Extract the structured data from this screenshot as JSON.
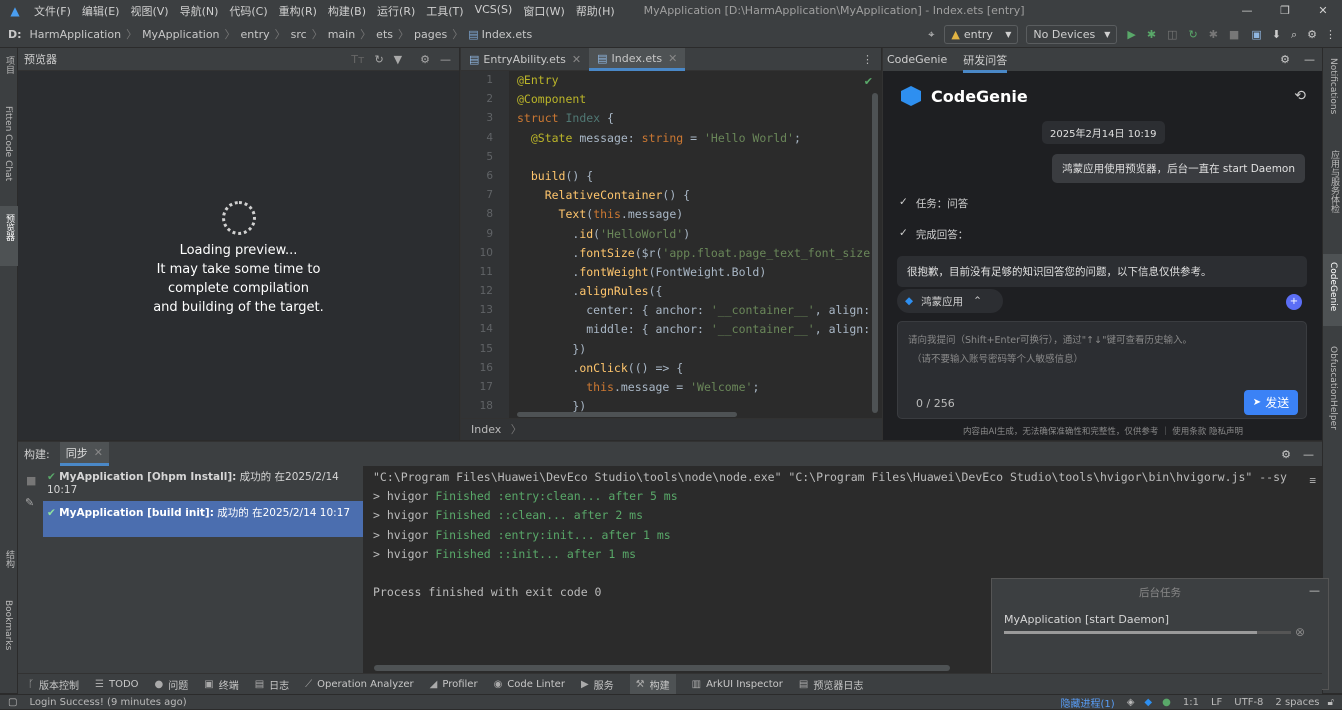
{
  "titlebar": {
    "menus": [
      "文件(F)",
      "编辑(E)",
      "视图(V)",
      "导航(N)",
      "代码(C)",
      "重构(R)",
      "构建(B)",
      "运行(R)",
      "工具(T)",
      "VCS(S)",
      "窗口(W)",
      "帮助(H)"
    ],
    "title": "MyApplication [D:\\HarmApplication\\MyApplication] - Index.ets [entry]"
  },
  "nav": {
    "drive": "D:",
    "crumbs": [
      "HarmApplication",
      "MyApplication",
      "entry",
      "src",
      "main",
      "ets",
      "pages",
      "Index.ets"
    ],
    "module": "entry",
    "device": "No Devices"
  },
  "left_strip": {
    "items": [
      "项目",
      "Fitten Code Chat",
      "预览器"
    ]
  },
  "right_strip": {
    "items": [
      "Notifications",
      "应用与服务体检",
      "CodeGenie",
      "ObfuscationHelper"
    ]
  },
  "preview": {
    "title": "预览器",
    "loading": [
      "Loading preview...",
      "It may take some time to",
      "complete compilation",
      "and building of the target."
    ]
  },
  "editor": {
    "tabs": [
      "EntryAbility.ets",
      "Index.ets"
    ],
    "footer": "Index",
    "line_numbers": [
      "1",
      "2",
      "3",
      "4",
      "5",
      "6",
      "7",
      "8",
      "9",
      "10",
      "11",
      "12",
      "13",
      "14",
      "15",
      "16",
      "17",
      "18"
    ]
  },
  "genie": {
    "tabs": [
      "CodeGenie",
      "研发问答"
    ],
    "brand": "CodeGenie",
    "timestamp": "2025年2月14日 10:19",
    "user_msg": "鸿蒙应用使用预览器，后台一直在 start Daemon",
    "step1": "任务：问答",
    "step2": "完成回答：",
    "answer": "很抱歉，目前没有足够的知识回答您的问题，以下信息仅供参考。",
    "chip": "鸿蒙应用",
    "placeholder_1": "请向我提问（Shift+Enter可换行），通过\"↑↓\"键可查看历史输入。",
    "placeholder_2": "（请不要输入账号密码等个人敏感信息）",
    "counter": "0 / 256",
    "send": "发送",
    "disclaimer": "内容由AI生成，无法确保准确性和完整性，仅供参考 ｜  使用条款  隐私声明"
  },
  "build": {
    "header_label": "构建:",
    "tab": "同步",
    "tree": [
      {
        "name": "MyApplication [Ohpm Install]:",
        "status": "成功的 在2025/2/14 10:17"
      },
      {
        "name": "MyApplication [build init]:",
        "status": "成功的 在2025/2/14 10:17"
      }
    ],
    "cmd": "\"C:\\Program Files\\Huawei\\DevEco Studio\\tools\\node\\node.exe\" \"C:\\Program Files\\Huawei\\DevEco Studio\\tools\\hvigor\\bin\\hvigorw.js\" --sy",
    "log": [
      {
        "prefix": "> hvigor ",
        "msg": "Finished :entry:clean... after 5 ms"
      },
      {
        "prefix": "> hvigor ",
        "msg": "Finished ::clean... after 2 ms"
      },
      {
        "prefix": "> hvigor ",
        "msg": "Finished :entry:init... after 1 ms"
      },
      {
        "prefix": "> hvigor ",
        "msg": "Finished ::init... after 1 ms"
      }
    ],
    "exit": "Process finished with exit code 0"
  },
  "bgtask": {
    "title": "后台任务",
    "task": "MyApplication [start Daemon]",
    "progress": 0.88
  },
  "toolwindows": [
    "版本控制",
    "TODO",
    "问题",
    "终端",
    "日志",
    "Operation Analyzer",
    "Profiler",
    "Code Linter",
    "服务",
    "构建",
    "ArkUI Inspector",
    "预览器日志"
  ],
  "statusbar": {
    "left": "Login Success! (9 minutes ago)",
    "hidden": "隐藏进程(1)",
    "pos": "1:1",
    "eol": "LF",
    "enc": "UTF-8",
    "indent": "2 spaces"
  },
  "colors": {
    "accent": "#4a88c7",
    "selection": "#4b6eaf",
    "success": "#59a869",
    "send": "#3b82f6"
  }
}
